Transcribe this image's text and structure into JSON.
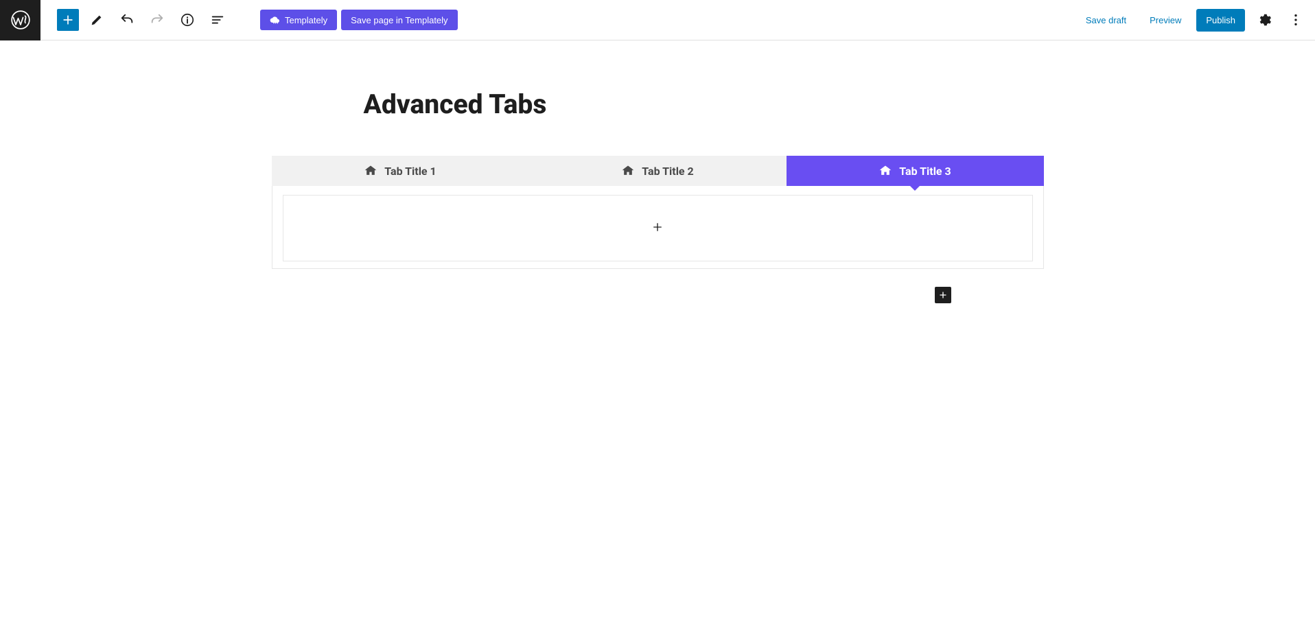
{
  "toolbar": {
    "templately_label": "Templately",
    "save_templately_label": "Save page in Templately",
    "save_draft_label": "Save draft",
    "preview_label": "Preview",
    "publish_label": "Publish"
  },
  "page": {
    "title": "Advanced Tabs"
  },
  "tabs": {
    "items": [
      {
        "label": "Tab Title 1",
        "active": false
      },
      {
        "label": "Tab Title 2",
        "active": false
      },
      {
        "label": "Tab Title 3",
        "active": true
      }
    ]
  },
  "colors": {
    "wp_blue": "#007cba",
    "templately_purple": "#5d4fe8",
    "tab_active": "#694ef2",
    "tab_inactive_bg": "#f1f1f1",
    "dark": "#1e1e1e"
  }
}
